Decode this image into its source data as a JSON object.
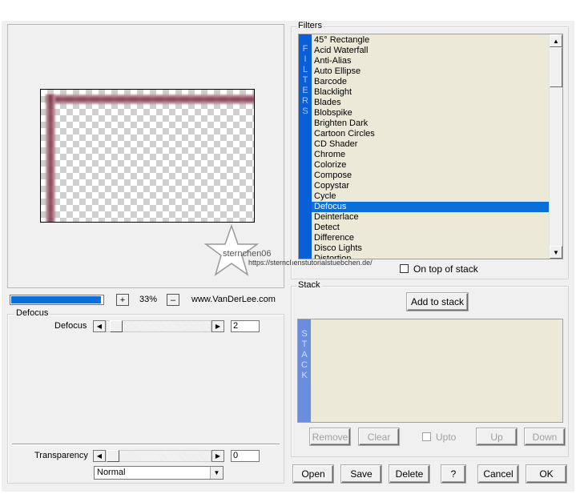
{
  "preview": {
    "zoom": "33%",
    "zoom_in": "+",
    "zoom_out": "–",
    "website": "www.VanDerLee.com",
    "progress_fraction": 0.98,
    "watermark_name": "sternchen06",
    "watermark_url": "https://sternchenstutorialstuebchen.de/"
  },
  "filters": {
    "group_label": "Filters",
    "side_label": [
      "F",
      "I",
      "L",
      "T",
      "E",
      "R",
      "S"
    ],
    "items": [
      "45° Rectangle",
      "Acid Waterfall",
      "Anti-Alias",
      "Auto Ellipse",
      "Barcode",
      "Blacklight",
      "Blades",
      "Blobspike",
      "Brighten Dark",
      "Cartoon Circles",
      "CD Shader",
      "Chrome",
      "Colorize",
      "Compose",
      "Copystar",
      "Cycle",
      "Defocus",
      "Deinterlace",
      "Detect",
      "Difference",
      "Disco Lights",
      "Distortion"
    ],
    "selected_index": 16,
    "on_top_label": "On top of stack"
  },
  "stack": {
    "group_label": "Stack",
    "add_label": "Add to stack",
    "side_label": [
      "S",
      "T",
      "A",
      "C",
      "K"
    ],
    "remove_label": "Remove",
    "clear_label": "Clear",
    "upto_label": "Upto",
    "up_label": "Up",
    "down_label": "Down"
  },
  "defocus": {
    "group_label": "Defocus",
    "param_label": "Defocus",
    "value": "2"
  },
  "transparency": {
    "label": "Transparency",
    "value": "0",
    "blend_mode": "Normal"
  },
  "buttons": {
    "open": "Open",
    "save": "Save",
    "delete": "Delete",
    "help": "?",
    "cancel": "Cancel",
    "ok": "OK"
  },
  "colors": {
    "selection": "#0a6fd8",
    "filter_strip": "#0a5ed8",
    "stack_strip": "#6a8de0",
    "list_bg": "#ece9d8"
  }
}
